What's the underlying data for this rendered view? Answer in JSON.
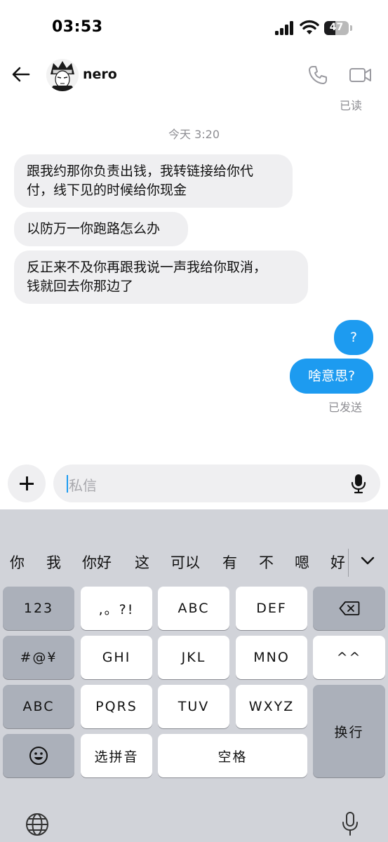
{
  "status_bar": {
    "time": "03:53",
    "battery": "47",
    "battery_level": 0.47
  },
  "header": {
    "contact_name": "nero",
    "read_status": "已读"
  },
  "conversation": {
    "time_divider": "今天 3:20",
    "incoming": [
      {
        "line1": "跟我约那你负责出钱，我转链接给你代",
        "line2": "付，线下见的时候给你现金"
      },
      {
        "line1": "以防万一你跑路怎么办"
      },
      {
        "line1": "反正来不及你再跟我说一声我给你取消，",
        "line2": "钱就回去你那边了"
      }
    ],
    "outgoing": [
      {
        "text": "?"
      },
      {
        "text": "啥意思?"
      }
    ],
    "sent_status": "已发送"
  },
  "composer": {
    "placeholder": "私信"
  },
  "keyboard": {
    "candidates": [
      "你",
      "我",
      "你好",
      "这",
      "可以",
      "有",
      "不",
      "嗯",
      "好"
    ],
    "keys": {
      "num": "123",
      "punct": ",。?!",
      "abc": "ABC",
      "def": "DEF",
      "symbols": "#@¥",
      "ghi": "GHI",
      "jkl": "JKL",
      "mno": "MNO",
      "caret": "^^",
      "abc_switch": "ABC",
      "pqrs": "PQRS",
      "tuv": "TUV",
      "wxyz": "WXYZ",
      "return": "换行",
      "pinyin": "选拼音",
      "space": "空格"
    }
  },
  "colors": {
    "accent": "#1d9bf0",
    "bubble_in": "#efeff1",
    "keyboard_bg": "#d1d3d9"
  }
}
